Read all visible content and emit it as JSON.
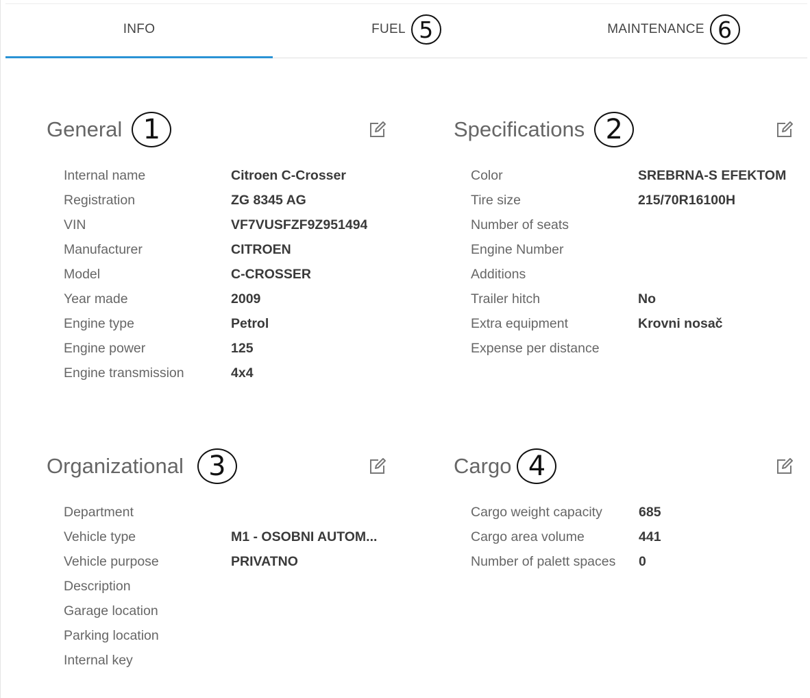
{
  "tabs": [
    {
      "label": "INFO",
      "marker": ""
    },
    {
      "label": "FUEL",
      "marker": "5"
    },
    {
      "label": "MAINTENANCE",
      "marker": "6"
    }
  ],
  "active_tab": "INFO",
  "accent_color": "#2a93d5",
  "sections": {
    "general": {
      "title": "General",
      "marker": "1",
      "rows": [
        {
          "label": "Internal name",
          "value": "Citroen C-Crosser"
        },
        {
          "label": "Registration",
          "value": "ZG 8345 AG"
        },
        {
          "label": "VIN",
          "value": "VF7VUSFZF9Z951494"
        },
        {
          "label": "Manufacturer",
          "value": "CITROEN"
        },
        {
          "label": "Model",
          "value": "C-CROSSER"
        },
        {
          "label": "Year made",
          "value": "2009"
        },
        {
          "label": "Engine type",
          "value": "Petrol"
        },
        {
          "label": "Engine power",
          "value": "125"
        },
        {
          "label": "Engine transmission",
          "value": "4x4"
        }
      ]
    },
    "specifications": {
      "title": "Specifications",
      "marker": "2",
      "rows": [
        {
          "label": "Color",
          "value": "SREBRNA-S EFEKTOM"
        },
        {
          "label": "Tire size",
          "value": "215/70R16100H"
        },
        {
          "label": "Number of seats",
          "value": ""
        },
        {
          "label": "Engine Number",
          "value": ""
        },
        {
          "label": "Additions",
          "value": ""
        },
        {
          "label": "Trailer hitch",
          "value": "No"
        },
        {
          "label": "Extra equipment",
          "value": "Krovni nosač"
        },
        {
          "label": "Expense per distance",
          "value": ""
        }
      ]
    },
    "organizational": {
      "title": "Organizational",
      "marker": "3",
      "rows": [
        {
          "label": "Department",
          "value": ""
        },
        {
          "label": "Vehicle type",
          "value": "M1 - OSOBNI AUTOM..."
        },
        {
          "label": "Vehicle purpose",
          "value": "PRIVATNO"
        },
        {
          "label": "Description",
          "value": ""
        },
        {
          "label": "Garage location",
          "value": ""
        },
        {
          "label": "Parking location",
          "value": ""
        },
        {
          "label": "Internal key",
          "value": ""
        }
      ]
    },
    "cargo": {
      "title": "Cargo",
      "marker": "4",
      "rows": [
        {
          "label": "Cargo weight capacity",
          "value": "685"
        },
        {
          "label": "Cargo area volume",
          "value": "441"
        },
        {
          "label": "Number of palett spaces",
          "value": "0"
        }
      ]
    }
  },
  "icons": {
    "edit": "edit-icon"
  }
}
